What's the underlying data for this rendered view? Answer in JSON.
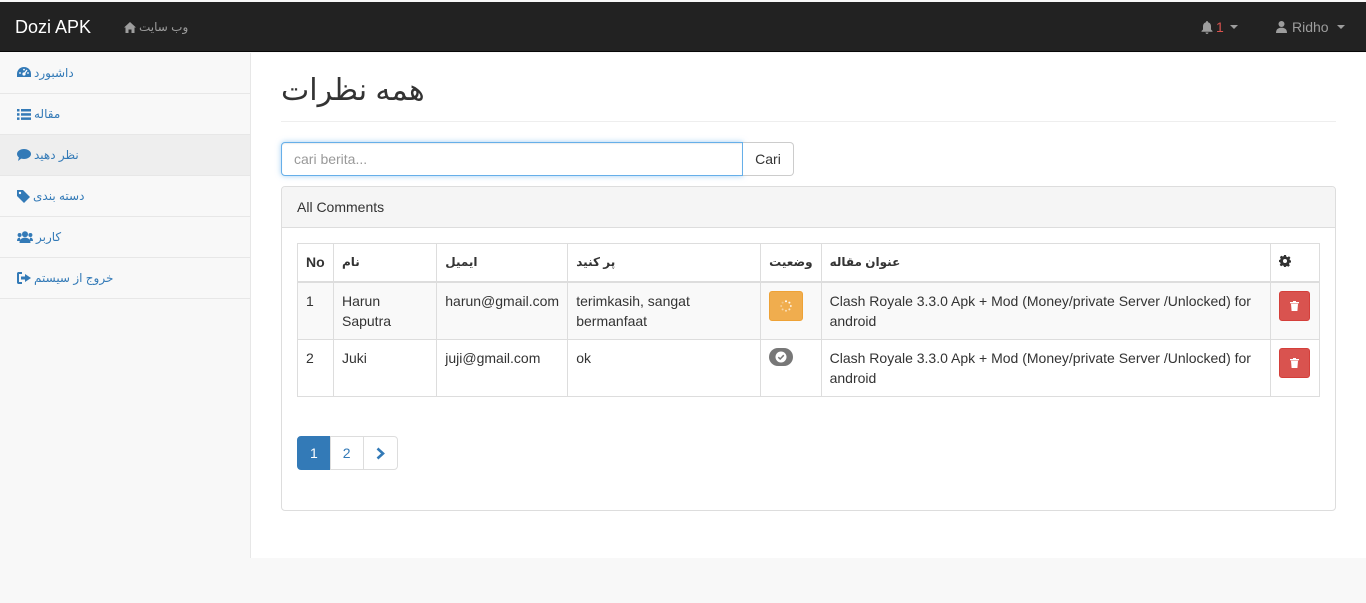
{
  "navbar": {
    "brand": "Dozi APK",
    "site_link": "وب سایت",
    "notifications_count": "1",
    "user_name": "Ridho"
  },
  "sidebar": {
    "items": [
      {
        "label": "داشبورد",
        "icon": "dashboard-icon"
      },
      {
        "label": "مقاله",
        "icon": "list-icon"
      },
      {
        "label": "نظر دهید",
        "icon": "comment-icon"
      },
      {
        "label": "دسته بندی",
        "icon": "tag-icon"
      },
      {
        "label": "کاربر",
        "icon": "users-icon"
      },
      {
        "label": "خروج از سیستم",
        "icon": "sign-out-icon"
      }
    ]
  },
  "main": {
    "title": "همه نظرات",
    "search": {
      "placeholder": "cari berita...",
      "value": "",
      "button_label": "Cari"
    },
    "panel_heading": "All Comments",
    "table": {
      "headers": [
        "No",
        "نام",
        "ایمیل",
        "پر کنید",
        "وضعیت",
        "عنوان مقاله"
      ],
      "rows": [
        {
          "no": "1",
          "name": "Harun Saputra",
          "email": "harun@gmail.com",
          "comment": "terimkasih, sangat bermanfaat",
          "status": "pending",
          "article": "Clash Royale 3.3.0 Apk + Mod (Money/private Server /Unlocked) for android"
        },
        {
          "no": "2",
          "name": "Juki",
          "email": "juji@gmail.com",
          "comment": "ok",
          "status": "approved",
          "article": "Clash Royale 3.3.0 Apk + Mod (Money/private Server /Unlocked) for android"
        }
      ]
    },
    "pagination": {
      "pages": [
        "1",
        "2"
      ],
      "current": "1"
    }
  },
  "colors": {
    "navbar_bg": "#222222",
    "link": "#337ab7",
    "warning": "#f0ad4e",
    "danger": "#d9534f",
    "default_badge": "#777777"
  }
}
